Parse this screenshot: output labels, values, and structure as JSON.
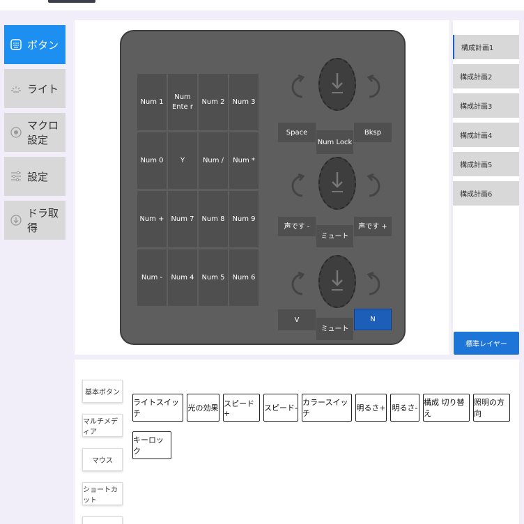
{
  "sidebar": {
    "items": [
      {
        "label": "ボタン",
        "icon": "keypad-icon"
      },
      {
        "label": "ライト",
        "icon": "light-icon"
      },
      {
        "label": "マクロ設定",
        "icon": "macro-icon"
      },
      {
        "label": "設定",
        "icon": "sliders-icon"
      },
      {
        "label": "ドラ取得",
        "icon": "download-icon"
      }
    ]
  },
  "device": {
    "keys": [
      [
        "Num 1",
        "Num Ente r",
        "Num 2",
        "Num 3"
      ],
      [
        "Num 0",
        "Y",
        "Num /",
        "Num *"
      ],
      [
        "Num +",
        "Num 7",
        "Num 8",
        "Num 9"
      ],
      [
        "Num -",
        "Num 4",
        "Num 5",
        "Num 6"
      ]
    ],
    "knobs": [
      {
        "left": "Space",
        "center": "Num Lock",
        "right": "Bksp"
      },
      {
        "left": "声です -",
        "center": "ミュート",
        "right": "声です +"
      },
      {
        "left": "V",
        "center": "ミュート",
        "right": "N"
      }
    ]
  },
  "profiles": [
    "構成計画1",
    "構成計画2",
    "構成計画3",
    "構成計画4",
    "構成計画5",
    "構成計画6"
  ],
  "layer_button": "標準レイヤー",
  "categories": [
    "基本ボタン",
    "マルチメディア",
    "マウス",
    "ショートカット"
  ],
  "functions": [
    "ライトスイッチ",
    "光の効果",
    "スピード+",
    "スピード-",
    "カラースイッチ",
    "明るさ+",
    "明るさ-",
    "構成 切り替え",
    "照明の方向",
    "キーロック"
  ],
  "colors": {
    "accent": "#1d8ff0",
    "device_body": "#5e5e5e",
    "key": "#4f4f4f",
    "active_key": "#1d5fb8"
  }
}
